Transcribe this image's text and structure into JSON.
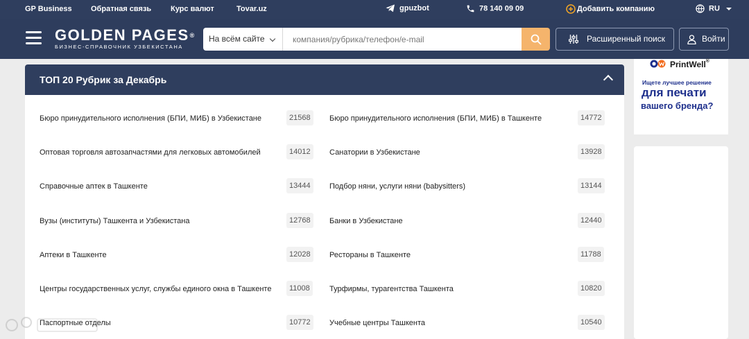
{
  "topbar": {
    "links": [
      "GP Business",
      "Обратная связь",
      "Курс валют",
      "Tovar.uz"
    ],
    "telegram": "gpuzbot",
    "phone": "78 140 09 09",
    "add_company": "Добавить компанию",
    "language": "RU"
  },
  "header": {
    "logo_title": "GOLDEN PAGES",
    "logo_reg": "®",
    "logo_subtitle": "БИЗНЕС-СПРАВОЧНИК УЗБЕКИСТАНА",
    "search_scope": "На всём сайте",
    "search_placeholder": "компания/рубрика/телефон/e-mail",
    "advanced_search": "Расширенный поиск",
    "login": "Войти"
  },
  "rubrics": {
    "title": "ТОП 20 Рубрик за Декабрь",
    "items": [
      {
        "name": "Бюро принудительного исполнения (БПИ, МИБ) в Узбекистане",
        "count": "21568"
      },
      {
        "name": "Бюро принудительного исполнения (БПИ, МИБ) в Ташкенте",
        "count": "14772"
      },
      {
        "name": "Оптовая торговля автозапчастями для легковых автомобилей",
        "count": "14012"
      },
      {
        "name": "Санатории в Узбекистане",
        "count": "13928"
      },
      {
        "name": "Справочные аптек в Ташкенте",
        "count": "13444"
      },
      {
        "name": "Подбор няни, услуги няни (babysitters)",
        "count": "13144"
      },
      {
        "name": "Вузы (институты) Ташкента и Узбекистана",
        "count": "12768"
      },
      {
        "name": "Банки в Узбекистане",
        "count": "12440"
      },
      {
        "name": "Аптеки в Ташкенте",
        "count": "12028"
      },
      {
        "name": "Рестораны в Ташкенте",
        "count": "11788"
      },
      {
        "name": "Центры государственных услуг, службы единого окна в Ташкенте",
        "count": "11008"
      },
      {
        "name": "Турфирмы, турагентства Ташкента",
        "count": "10820"
      },
      {
        "name": "Паспортные отделы",
        "count": "10772"
      },
      {
        "name": "Учебные центры Ташкента",
        "count": "10540"
      }
    ]
  },
  "ad": {
    "brand": "PrintWell",
    "brand_reg": "®",
    "tagline": "Ищете лучшее решение",
    "headline": "для печати",
    "subline": "вашего бренда?"
  },
  "colors": {
    "header_bg": "#2e3d5d",
    "search_button": "#f5b46c",
    "add_company_accent": "#f5a623",
    "ad_text": "#1d2f8c"
  }
}
